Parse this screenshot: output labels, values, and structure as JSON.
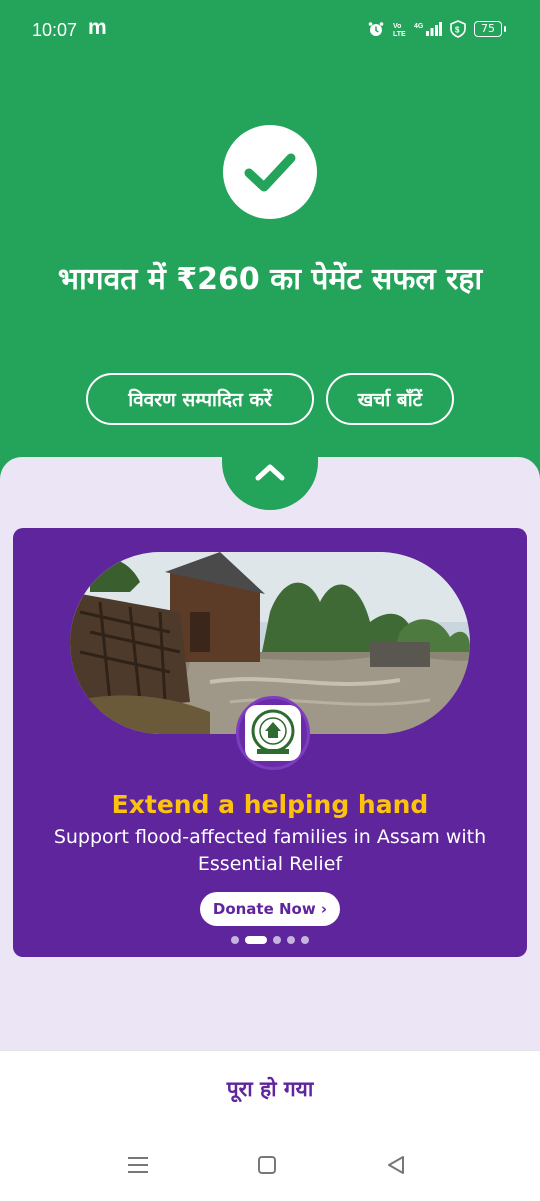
{
  "status_bar": {
    "time": "10:07",
    "app_glyph": "m",
    "battery": "75",
    "icons": [
      "alarm-icon",
      "volte-icon",
      "signal-icon",
      "vpn-icon",
      "battery-icon"
    ]
  },
  "success": {
    "title": "भागवत में ₹260 का पेमेंट सफल रहा"
  },
  "actions": {
    "edit_label": "विवरण सम्पादित करें",
    "split_label": "खर्चा बाँटें"
  },
  "banner": {
    "headline": "Extend a helping hand",
    "subtext": "Support flood-affected families in Assam with Essential Relief",
    "cta": "Donate Now ›",
    "dots": 5,
    "active_dot": 1
  },
  "footer": {
    "done_label": "पूरा हो गया"
  },
  "colors": {
    "green": "#23a45a",
    "purple": "#5e259d",
    "yellow": "#fcc20e",
    "lavender": "#ece5f6"
  }
}
